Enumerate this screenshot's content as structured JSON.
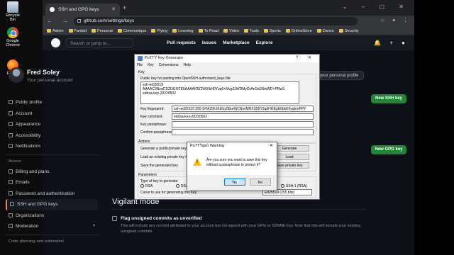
{
  "desktop": {
    "icons": [
      {
        "label": "Recycle Bin"
      },
      {
        "label": "Google Chrome"
      },
      {
        "label": "Firefox"
      }
    ]
  },
  "browser": {
    "tab_title": "SSH and GPG keys",
    "url": "github.com/settings/keys",
    "bookmarks": [
      "Admin",
      "Fardad",
      "Personal",
      "Communique",
      "Flying",
      "Learning",
      "To Read",
      "Video",
      "Tools",
      "Sports",
      "OnlineStore",
      "Dance",
      "Security"
    ]
  },
  "github": {
    "search_placeholder": "Search or jump to...",
    "nav": [
      "Pull requests",
      "Issues",
      "Marketplace",
      "Explore"
    ],
    "user_name": "Fred Soley",
    "user_sub": "Your personal account",
    "profile_button": "Go to your personal profile",
    "new_ssh_button": "New SSH key",
    "new_gpg_button": "New GPG key",
    "sidebar": {
      "items_top": [
        "Public profile",
        "Account",
        "Appearance",
        "Accessibility",
        "Notifications"
      ],
      "access_heading": "Access",
      "items_access": [
        "Billing and plans",
        "Emails",
        "Password and authentication",
        "SSH and GPG keys",
        "Organizations",
        "Moderation"
      ],
      "code_heading": "Code, planning, and automation"
    },
    "vigilant_title": "Vigilant mode",
    "vigilant_check": "Flag unsigned commits as unverified",
    "vigilant_desc": "This will include any commit attributed to your account but not signed with your GPG or S/MIME key. Note that this will include your existing unsigned commits."
  },
  "putty": {
    "title": "PuTTY Key Generator",
    "menu": [
      "File",
      "Key",
      "Conversions",
      "Help"
    ],
    "key_label": "Key",
    "public_key_label": "Public key for pasting into OpenSSH authorized_keys file:",
    "public_key_line1": "ssh-ed25519 AAAAC3NzaC1lZDI1NTE5AAAAIOE2WX/kH0Yuq6+Mvg3JWDMyGrAe1bGNwWD+PRwS",
    "public_key_line2": "eddsa-key-20220502",
    "fingerprint_label": "Key fingerprint:",
    "fingerprint_value": "ssh-ed25519 255 SHA256:tKk5oZEkeHjCNsvMHXS56Y3qdHGEpE6bkK6yqbmPPY",
    "comment_label": "Key comment:",
    "comment_value": "eddsa-key-20220502",
    "passphrase_label": "Key passphrase:",
    "confirm_label": "Confirm passphrase:",
    "actions_label": "Actions",
    "generate_label": "Generate a public/private key pa",
    "load_label": "Load an existing private key file",
    "save_label": "Save the generated key",
    "generate_button": "Generate",
    "load_button": "Load",
    "save_private_button": "Save private key",
    "parameters_label": "Parameters",
    "type_label": "Type of key to generate:",
    "rsa_label": "RSA",
    "dsa_label": "DSA",
    "ssh1_label": "SSH-1 (RSA)",
    "curve_label": "Curve to use for generating this key:",
    "curve_value": "Ed25519 (255 bits)"
  },
  "warning": {
    "title": "PuTTYgen Warning",
    "message": "Are you sure you want to save this key without a passphrase to protect it?",
    "yes": "Yes",
    "no": "No"
  }
}
